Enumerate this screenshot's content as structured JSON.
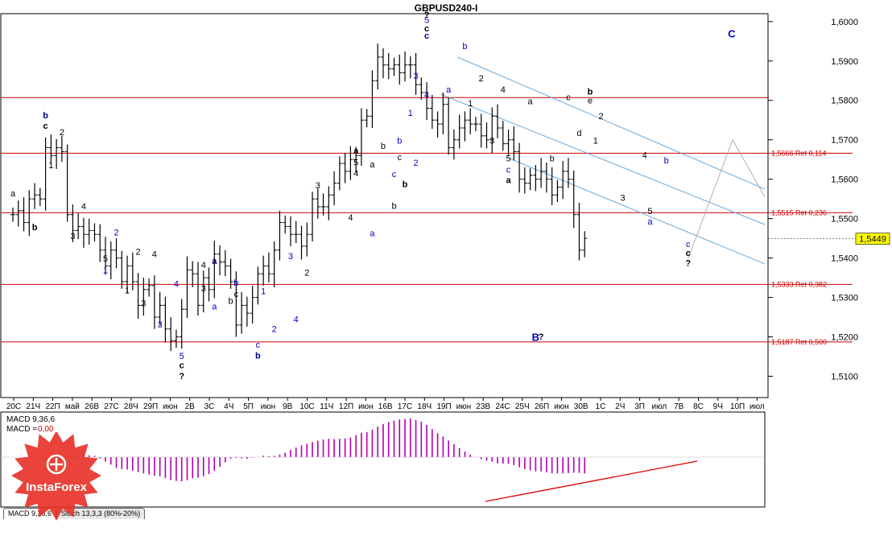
{
  "chart_data": {
    "type": "ohlc",
    "title": "GBPUSD240-I",
    "ylim": [
      1.505,
      1.602
    ],
    "yticks": [
      "1,6000",
      "1,5900",
      "1,5800",
      "1,5700",
      "1,5600",
      "1,5500",
      "1,5400",
      "1,5300",
      "1,5200",
      "1,5100"
    ],
    "ytick_values": [
      1.6,
      1.59,
      1.58,
      1.57,
      1.56,
      1.55,
      1.54,
      1.53,
      1.52,
      1.51
    ],
    "current_price_label": "1,5449",
    "current_price": 1.5449,
    "xticks": [
      "20С",
      "21Ч",
      "22П",
      "май",
      "26В",
      "27С",
      "28Ч",
      "29П",
      "июн",
      "2В",
      "3С",
      "4Ч",
      "5П",
      "июн",
      "9В",
      "10С",
      "11Ч",
      "12П",
      "июн",
      "16В",
      "17С",
      "18Ч",
      "19П",
      "июн",
      "23В",
      "24С",
      "25Ч",
      "26П",
      "июн",
      "30В",
      "1С",
      "2Ч",
      "3П",
      "июл",
      "7В",
      "8С",
      "9Ч",
      "10П",
      "июл"
    ],
    "levels": [
      {
        "value": 1.5666,
        "label": "1,5666 Ret 0,114"
      },
      {
        "value": 1.5515,
        "label": "1,5515 Ret 0,236"
      },
      {
        "value": 1.5333,
        "label": "1,5333 Ret 0,382"
      },
      {
        "value": 1.5187,
        "label": "1,5187 Ret 0,500"
      },
      {
        "value": 1.5807,
        "label": ""
      }
    ],
    "series": [
      {
        "values": [
          1.551,
          1.552,
          1.549,
          1.555,
          1.556,
          1.555,
          1.568,
          1.566,
          1.568,
          1.567,
          1.551,
          1.547,
          1.548,
          1.546,
          1.547,
          1.546,
          1.542,
          1.538,
          1.542,
          1.54,
          1.534,
          1.538,
          1.534,
          1.528,
          1.532,
          1.533,
          1.525,
          1.528,
          1.522,
          1.519,
          1.52,
          1.527,
          1.537,
          1.536,
          1.528,
          1.535,
          1.532,
          1.541,
          1.539,
          1.538,
          1.534,
          1.523,
          1.528,
          1.526,
          1.53,
          1.536,
          1.538,
          1.536,
          1.542,
          1.549,
          1.548,
          1.546,
          1.546,
          1.543,
          1.546,
          1.555,
          1.553,
          1.553,
          1.556,
          1.559,
          1.564,
          1.562,
          1.565,
          1.566,
          1.575,
          1.576,
          1.585,
          1.591,
          1.589,
          1.588,
          1.589,
          1.587,
          1.589,
          1.589,
          1.584,
          1.582,
          1.578,
          1.575,
          1.574,
          1.579,
          1.568,
          1.57,
          1.573,
          1.575,
          1.574,
          1.574,
          1.571,
          1.57,
          1.576,
          1.573,
          1.569,
          1.57,
          1.567,
          1.56,
          1.559,
          1.561,
          1.56,
          1.562,
          1.56,
          1.556,
          1.558,
          1.562,
          1.56,
          1.551,
          1.542,
          1.545
        ]
      }
    ],
    "wave_labels": [
      {
        "t": "b",
        "i": 6,
        "v": 1.5755,
        "c": "#00008b",
        "bold": true
      },
      {
        "t": "c",
        "i": 6,
        "v": 1.5728,
        "c": "#000",
        "bold": true
      },
      {
        "t": "2",
        "i": 9,
        "v": 1.5712,
        "c": "#000"
      },
      {
        "t": "1",
        "i": 7,
        "v": 1.5628,
        "c": "#000"
      },
      {
        "t": "4",
        "i": 13,
        "v": 1.5524,
        "c": "#000"
      },
      {
        "t": "3",
        "i": 11,
        "v": 1.5448,
        "c": "#000"
      },
      {
        "t": "b",
        "i": 4,
        "v": 1.5471,
        "c": "#000",
        "bold": true
      },
      {
        "t": "a",
        "i": 0,
        "v": 1.5556,
        "c": "#000"
      },
      {
        "t": "2",
        "i": 19,
        "v": 1.5457,
        "c": "#0000cd"
      },
      {
        "t": "5",
        "i": 17,
        "v": 1.5391,
        "c": "#000"
      },
      {
        "t": "1",
        "i": 17,
        "v": 1.5361,
        "c": "#0000cd"
      },
      {
        "t": "2",
        "i": 23,
        "v": 1.5408,
        "c": "#000"
      },
      {
        "t": "1",
        "i": 21,
        "v": 1.531,
        "c": "#000"
      },
      {
        "t": "4",
        "i": 26,
        "v": 1.5402,
        "c": "#000"
      },
      {
        "t": "3",
        "i": 24,
        "v": 1.5278,
        "c": "#000"
      },
      {
        "t": "4",
        "i": 30,
        "v": 1.5327,
        "c": "#0000cd"
      },
      {
        "t": "3",
        "i": 27,
        "v": 1.5224,
        "c": "#0000cd"
      },
      {
        "t": "5",
        "i": 31,
        "v": 1.5144,
        "c": "#0000cd"
      },
      {
        "t": "c",
        "i": 31,
        "v": 1.512,
        "c": "#000",
        "bold": true
      },
      {
        "t": "?",
        "i": 31,
        "v": 1.5093,
        "c": "#000",
        "bold": true
      },
      {
        "t": "a",
        "i": 37,
        "v": 1.5385,
        "c": "#00008b",
        "bold": true
      },
      {
        "t": "4",
        "i": 35,
        "v": 1.5375,
        "c": "#000"
      },
      {
        "t": "3",
        "i": 35,
        "v": 1.5315,
        "c": "#000"
      },
      {
        "t": "a",
        "i": 37,
        "v": 1.527,
        "c": "#0000cd"
      },
      {
        "t": "b",
        "i": 41,
        "v": 1.533,
        "c": "#0000cd"
      },
      {
        "t": "c",
        "i": 41,
        "v": 1.5301,
        "c": "#000"
      },
      {
        "t": "b",
        "i": 40,
        "v": 1.5284,
        "c": "#000"
      },
      {
        "t": "c",
        "i": 45,
        "v": 1.5173,
        "c": "#0000cd"
      },
      {
        "t": "b",
        "i": 45,
        "v": 1.5145,
        "c": "#00008b",
        "bold": true
      },
      {
        "t": "1",
        "i": 46,
        "v": 1.5308,
        "c": "#0000cd"
      },
      {
        "t": "2",
        "i": 48,
        "v": 1.5212,
        "c": "#0000cd"
      },
      {
        "t": "3",
        "i": 51,
        "v": 1.5397,
        "c": "#0000cd"
      },
      {
        "t": "2",
        "i": 54,
        "v": 1.5355,
        "c": "#000"
      },
      {
        "t": "4",
        "i": 52,
        "v": 1.5237,
        "c": "#0000cd"
      },
      {
        "t": "3",
        "i": 56,
        "v": 1.5577,
        "c": "#000"
      },
      {
        "t": "4",
        "i": 62,
        "v": 1.5495,
        "c": "#000"
      },
      {
        "t": "a",
        "i": 63,
        "v": 1.5665,
        "c": "#000",
        "bold": true
      },
      {
        "t": "5",
        "i": 63,
        "v": 1.5635,
        "c": "#000"
      },
      {
        "t": "4",
        "i": 63,
        "v": 1.5608,
        "c": "#000"
      },
      {
        "t": "a",
        "i": 66,
        "v": 1.563,
        "c": "#000"
      },
      {
        "t": "b",
        "i": 68,
        "v": 1.5677,
        "c": "#000"
      },
      {
        "t": "c",
        "i": 71,
        "v": 1.5648,
        "c": "#000"
      },
      {
        "t": "a",
        "i": 66,
        "v": 1.5455,
        "c": "#0000cd"
      },
      {
        "t": "b",
        "i": 70,
        "v": 1.5525,
        "c": "#000"
      },
      {
        "t": "b",
        "i": 71,
        "v": 1.569,
        "c": "#0000cd"
      },
      {
        "t": "c",
        "i": 70,
        "v": 1.5605,
        "c": "#0000cd"
      },
      {
        "t": "2",
        "i": 74,
        "v": 1.5634,
        "c": "#0000cd"
      },
      {
        "t": "b",
        "i": 72,
        "v": 1.558,
        "c": "#000",
        "bold": true
      },
      {
        "t": "1",
        "i": 73,
        "v": 1.5761,
        "c": "#0000cd"
      },
      {
        "t": "3",
        "i": 74,
        "v": 1.5855,
        "c": "#0000cd"
      },
      {
        "t": "4",
        "i": 76,
        "v": 1.5807,
        "c": "#0000cd"
      },
      {
        "t": "5",
        "i": 76,
        "v": 1.5997,
        "c": "#0000cd"
      },
      {
        "t": "c",
        "i": 76,
        "v": 1.5975,
        "c": "#000",
        "bold": true
      },
      {
        "t": "c",
        "i": 76,
        "v": 1.5957,
        "c": "#00008b",
        "bold": true
      },
      {
        "t": "?",
        "i": 76,
        "v": 1.601,
        "c": "#000",
        "bold": true
      },
      {
        "t": "a",
        "i": 80,
        "v": 1.582,
        "c": "#0000cd"
      },
      {
        "t": "b",
        "i": 83,
        "v": 1.593,
        "c": "#0000cd"
      },
      {
        "t": "1",
        "i": 84,
        "v": 1.5785,
        "c": "#000"
      },
      {
        "t": "2",
        "i": 86,
        "v": 1.5848,
        "c": "#000"
      },
      {
        "t": "3",
        "i": 88,
        "v": 1.569,
        "c": "#000"
      },
      {
        "t": "4",
        "i": 90,
        "v": 1.582,
        "c": "#000"
      },
      {
        "t": "5",
        "i": 91,
        "v": 1.5645,
        "c": "#000"
      },
      {
        "t": "c",
        "i": 91,
        "v": 1.5617,
        "c": "#0000cd"
      },
      {
        "t": "a",
        "i": 91,
        "v": 1.559,
        "c": "#000",
        "bold": true
      },
      {
        "t": "a",
        "i": 95,
        "v": 1.579,
        "c": "#000"
      },
      {
        "t": "b",
        "i": 99,
        "v": 1.5645,
        "c": "#000"
      },
      {
        "t": "c",
        "i": 102,
        "v": 1.58,
        "c": "#000"
      },
      {
        "t": "b",
        "i": 106,
        "v": 1.5815,
        "c": "#000",
        "bold": true
      },
      {
        "t": "e",
        "i": 106,
        "v": 1.5792,
        "c": "#000"
      },
      {
        "t": "d",
        "i": 104,
        "v": 1.571,
        "c": "#000"
      },
      {
        "t": "1",
        "i": 107,
        "v": 1.569,
        "c": "#000"
      },
      {
        "t": "2",
        "i": 108,
        "v": 1.5752,
        "c": "#000"
      },
      {
        "t": "3",
        "i": 112,
        "v": 1.5545,
        "c": "#000"
      },
      {
        "t": "4",
        "i": 116,
        "v": 1.5653,
        "c": "#000"
      },
      {
        "t": "5",
        "i": 117,
        "v": 1.5512,
        "c": "#000"
      },
      {
        "t": "a",
        "i": 117,
        "v": 1.5485,
        "c": "#0000cd"
      },
      {
        "t": "b",
        "i": 120,
        "v": 1.564,
        "c": "#0000cd"
      },
      {
        "t": "c",
        "i": 124,
        "v": 1.5428,
        "c": "#0000cd"
      },
      {
        "t": "c",
        "i": 124,
        "v": 1.5405,
        "c": "#000",
        "bold": true
      },
      {
        "t": "?",
        "i": 124,
        "v": 1.538,
        "c": "#000",
        "bold": true
      },
      {
        "t": "C",
        "i": 132,
        "v": 1.596,
        "c": "#0000cd",
        "bold": true
      },
      {
        "t": "B",
        "i": 96,
        "v": 1.519,
        "c": "#0000cd",
        "bold": true
      },
      {
        "t": "?",
        "i": 97,
        "v": 1.5193,
        "c": "#000",
        "bold": true
      }
    ],
    "macd_label": "MACD 9,36,6",
    "macd_eq_label": "MACD =",
    "macd_value": "0,00",
    "tabs": [
      "MACD 9,36,6",
      "Stoch 13,3,3 (80%-20%)"
    ],
    "logo_text": "InstaForex",
    "colors": {
      "level": "#cc0000",
      "channel": "#6aa7d8",
      "macd": "#b000b0",
      "trend": "#dd0000",
      "label_blue": "#0000cd",
      "projection": "#b0b0b0"
    }
  }
}
